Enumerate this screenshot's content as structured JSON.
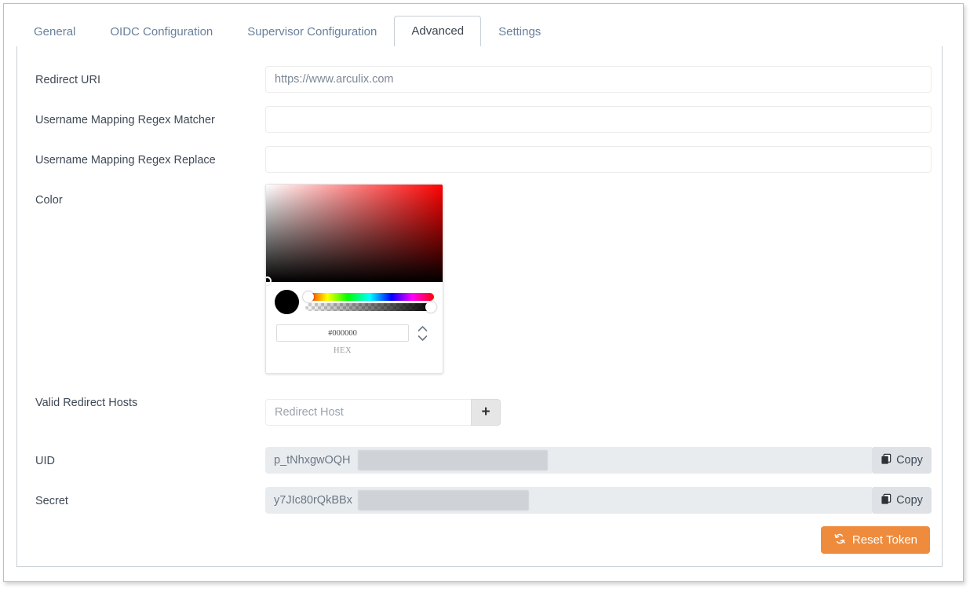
{
  "window": {
    "tabs": [
      {
        "label": "General",
        "active": false
      },
      {
        "label": "OIDC Configuration",
        "active": false
      },
      {
        "label": "Supervisor Configuration",
        "active": false
      },
      {
        "label": "Advanced",
        "active": true
      },
      {
        "label": "Settings",
        "active": false
      }
    ]
  },
  "form": {
    "redirect_uri": {
      "label": "Redirect URI",
      "value": "https://www.arculix.com",
      "placeholder": ""
    },
    "username_regex_matcher": {
      "label": "Username Mapping Regex Matcher",
      "value": "",
      "placeholder": ""
    },
    "username_regex_replace": {
      "label": "Username Mapping Regex Replace",
      "value": "",
      "placeholder": ""
    },
    "color": {
      "label": "Color",
      "hex_value": "#000000",
      "hex_format_label": "HEX",
      "preview_color": "#000000",
      "hue_color": "#ff0000"
    },
    "valid_redirect_hosts": {
      "label": "Valid Redirect Hosts",
      "placeholder": "Redirect Host",
      "value": "",
      "add_button_label": "+"
    },
    "uid": {
      "label": "UID",
      "value": "p_tNhxgwOQH",
      "copy_label": "Copy"
    },
    "secret": {
      "label": "Secret",
      "value": "y7JIc80rQkBBx",
      "copy_label": "Copy"
    }
  },
  "actions": {
    "reset_token_label": "Reset Token"
  },
  "colors": {
    "accent_orange": "#ef8b3c",
    "tab_inactive_text": "#68809c",
    "tab_active_text": "#3c444c",
    "label_text": "#3f4954",
    "readonly_bg": "#e9ecef"
  }
}
